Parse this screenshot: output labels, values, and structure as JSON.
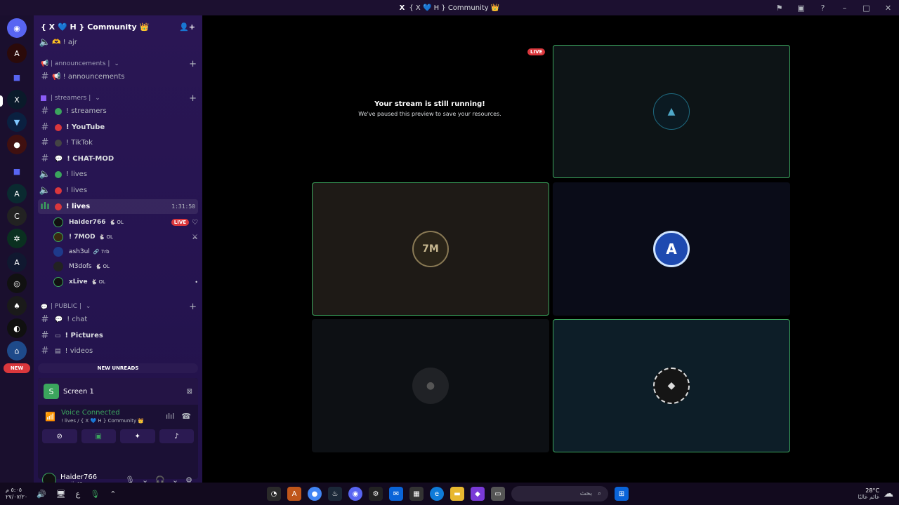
{
  "window": {
    "title": "{ X 💙 H } Community 👑",
    "icon": "X"
  },
  "server": {
    "name": "{ X 💙 H } Community 👑"
  },
  "channels": {
    "top": {
      "name": "🫶 ! ajr"
    },
    "cat_announcements": "📢 | announcements |",
    "announcements": "📢 ! announcements",
    "cat_streamers": "| streamers |",
    "streamers": "! streamers",
    "youtube": "! YouTube",
    "tiktok": "! TikTok",
    "chatmod": "! CHAT-MOD",
    "lives1": "! lives",
    "lives2": "! lives",
    "lives3": "! lives",
    "lives3_time": "1:31:50",
    "cat_public": "| PUBLIC |",
    "chat": "! chat",
    "pictures": "! Pictures",
    "videos": "! videos"
  },
  "voice_users": [
    {
      "name": "Haider766",
      "tag": "🐇 OL",
      "live": "LIVE"
    },
    {
      "name": "! 7MOD",
      "tag": "🐇 OL"
    },
    {
      "name": "ash3ul",
      "tag": "🔗 7rb"
    },
    {
      "name": "M3dofs",
      "tag": "🐇 OL"
    },
    {
      "name": "xLive",
      "tag": "🐇 OL"
    }
  ],
  "new_unreads": "NEW UNREADS",
  "guild_new": "NEW",
  "screen_panel": {
    "label": "Screen 1"
  },
  "voice": {
    "status": "Voice Connected",
    "location": "! lives / { X 💙 H } Community 👑"
  },
  "user": {
    "name": "Haider766",
    "status": "emoji_42"
  },
  "stage": {
    "paused_title": "Your stream is still running!",
    "paused_sub": "We've paused this preview to save your resources.",
    "live": "LIVE",
    "tile_7m": "7M"
  },
  "taskbar": {
    "time": "٥:٠٥ م",
    "date": "٢٧/٠٧/٢٠",
    "lang": "ع",
    "search": "بحث",
    "temp": "28°C",
    "weather": "غائم غالبًا"
  },
  "colors": {
    "accent_green": "#3ba55d",
    "live_red": "#da373c"
  }
}
